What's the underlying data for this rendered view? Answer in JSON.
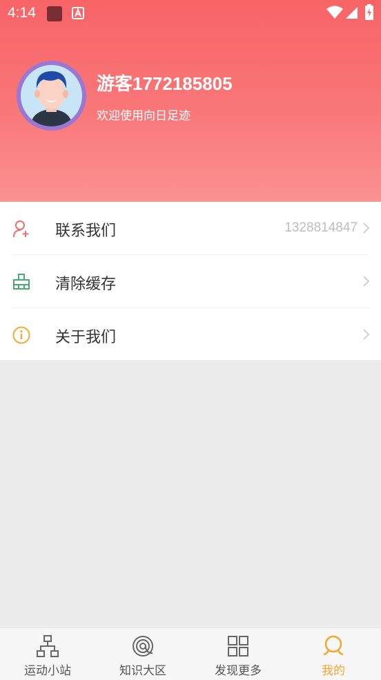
{
  "status_bar": {
    "time": "4:14"
  },
  "profile": {
    "username": "游客1772185805",
    "welcome": "欢迎使用向日足迹"
  },
  "menu": [
    {
      "label": "联系我们",
      "value": "1328814847",
      "icon": "add-user-icon"
    },
    {
      "label": "清除缓存",
      "value": "",
      "icon": "broom-icon"
    },
    {
      "label": "关于我们",
      "value": "",
      "icon": "info-icon"
    }
  ],
  "tabs": [
    {
      "label": "运动小站",
      "icon": "hierarchy-icon",
      "active": false
    },
    {
      "label": "知识大区",
      "icon": "spiral-icon",
      "active": false
    },
    {
      "label": "发现更多",
      "icon": "grid-icon",
      "active": false
    },
    {
      "label": "我的",
      "icon": "profile-icon",
      "active": true
    }
  ],
  "colors": {
    "header_top": "#f76466",
    "header_bottom": "#fb9293",
    "accent": "#f4a52b",
    "avatar_ring": "#9a77d2"
  }
}
